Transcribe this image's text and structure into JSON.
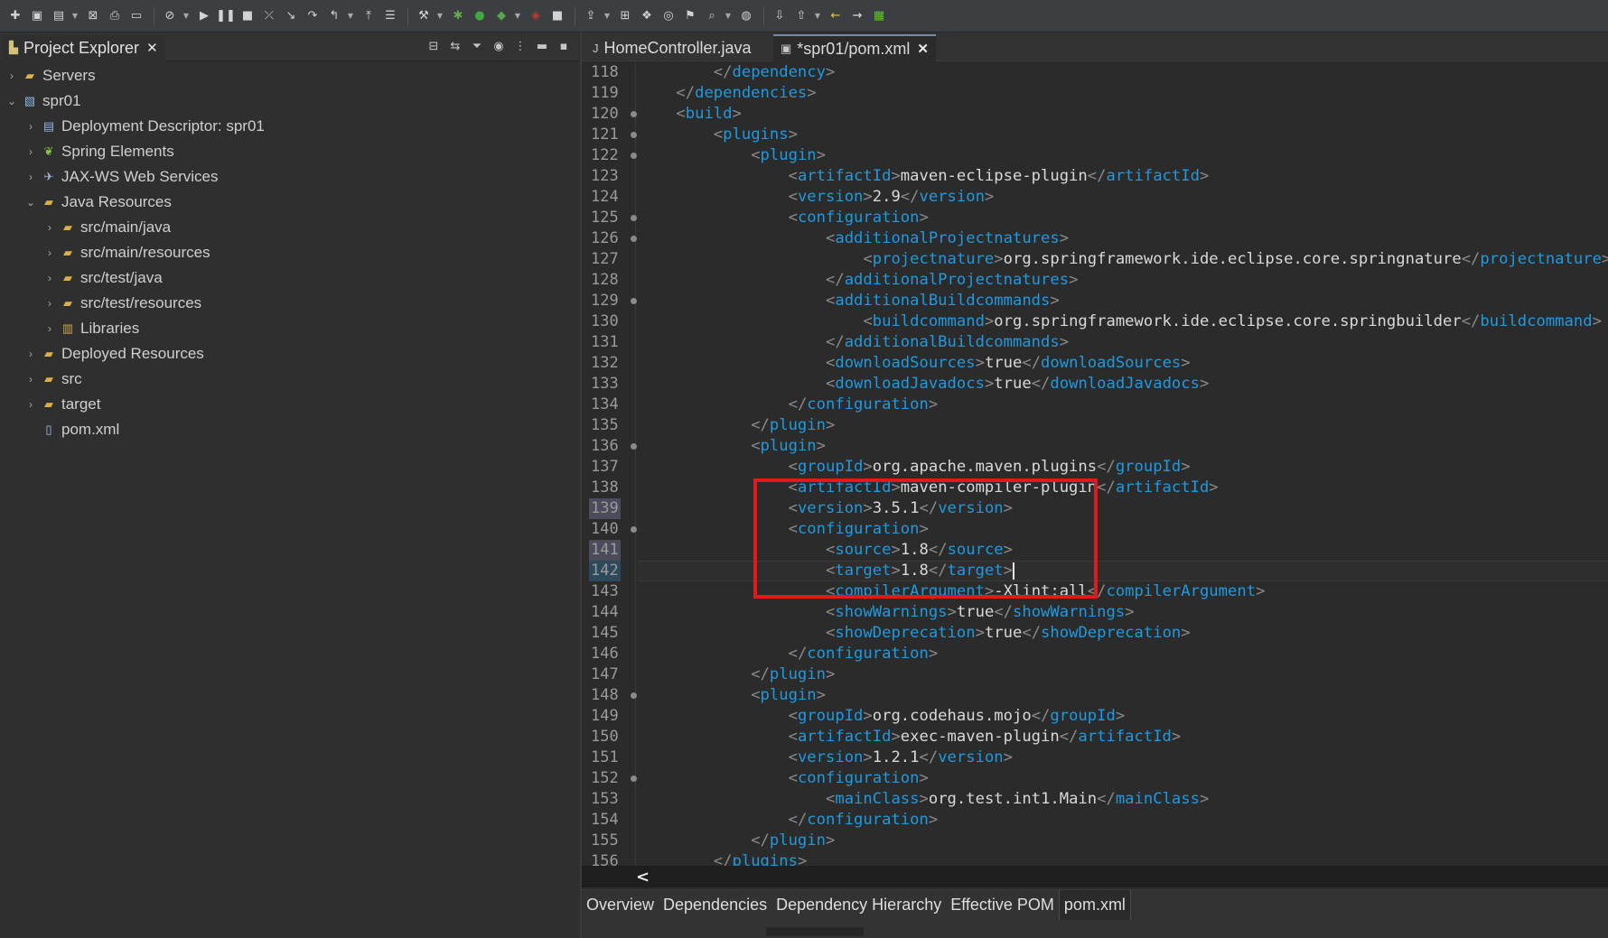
{
  "toolbar": {
    "icons": [
      "new-icon",
      "save-icon",
      "save-all-icon",
      "debug-skip-icon",
      "print-icon",
      "terminal-icon",
      "skip-breakpoints-icon",
      "resume-icon",
      "suspend-icon",
      "terminate-icon",
      "disconnect-icon",
      "step-into-icon",
      "step-over-icon",
      "step-return-icon",
      "drop-frame-icon",
      "use-step-filters-icon",
      "build-all-icon",
      "debug-icon",
      "run-icon",
      "run-server-icon",
      "external-tools-icon",
      "stop-icon",
      "deploy-icon",
      "new-server-icon",
      "new-java-project-icon",
      "open-type-icon",
      "open-task-icon",
      "search-icon",
      "open-perspective-icon",
      "next-annotation-icon",
      "prev-annotation-icon",
      "back-icon",
      "forward-icon",
      "outline-icon"
    ]
  },
  "project_explorer": {
    "title": "Project Explorer",
    "close_glyph": "✕",
    "tree": [
      {
        "label": "Servers",
        "level": 0,
        "twisty": "›",
        "icon": "folder-icon"
      },
      {
        "label": "spr01",
        "level": 0,
        "twisty": "⌄",
        "icon": "project-icon"
      },
      {
        "label": "Deployment Descriptor: spr01",
        "level": 1,
        "twisty": "›",
        "icon": "deployment-descriptor-icon"
      },
      {
        "label": "Spring Elements",
        "level": 1,
        "twisty": "›",
        "icon": "spring-icon"
      },
      {
        "label": "JAX-WS Web Services",
        "level": 1,
        "twisty": "›",
        "icon": "web-services-icon"
      },
      {
        "label": "Java Resources",
        "level": 1,
        "twisty": "⌄",
        "icon": "java-resources-icon"
      },
      {
        "label": "src/main/java",
        "level": 2,
        "twisty": "›",
        "icon": "package-folder-icon"
      },
      {
        "label": "src/main/resources",
        "level": 2,
        "twisty": "›",
        "icon": "package-folder-icon"
      },
      {
        "label": "src/test/java",
        "level": 2,
        "twisty": "›",
        "icon": "package-folder-icon"
      },
      {
        "label": "src/test/resources",
        "level": 2,
        "twisty": "›",
        "icon": "package-folder-icon"
      },
      {
        "label": "Libraries",
        "level": 2,
        "twisty": "›",
        "icon": "libraries-icon"
      },
      {
        "label": "Deployed Resources",
        "level": 1,
        "twisty": "›",
        "icon": "deployed-resources-icon"
      },
      {
        "label": "src",
        "level": 1,
        "twisty": "›",
        "icon": "folder-icon"
      },
      {
        "label": "target",
        "level": 1,
        "twisty": "›",
        "icon": "folder-icon"
      },
      {
        "label": "pom.xml",
        "level": 1,
        "twisty": "",
        "icon": "xml-file-icon"
      }
    ]
  },
  "editor": {
    "tabs": [
      {
        "label": "HomeController.java",
        "active": false
      },
      {
        "label": "*spr01/pom.xml",
        "active": true
      }
    ],
    "tab_close_glyph": "✕",
    "hscroll_arrow": "<",
    "bottom_tabs": [
      "Overview",
      "Dependencies",
      "Dependency Hierarchy",
      "Effective POM",
      "pom.xml"
    ],
    "active_bottom_tab": "pom.xml",
    "lines": [
      {
        "n": "118",
        "indent": 2,
        "tag": "dependency",
        "kind": "close"
      },
      {
        "n": "119",
        "indent": 1,
        "tag": "dependencies",
        "kind": "close"
      },
      {
        "n": "120",
        "indent": 1,
        "tag": "build",
        "kind": "open",
        "fold": true
      },
      {
        "n": "121",
        "indent": 2,
        "tag": "plugins",
        "kind": "open",
        "fold": true
      },
      {
        "n": "122",
        "indent": 3,
        "tag": "plugin",
        "kind": "open",
        "fold": true
      },
      {
        "n": "123",
        "indent": 4,
        "tag": "artifactId",
        "kind": "elem",
        "value": "maven-eclipse-plugin"
      },
      {
        "n": "124",
        "indent": 4,
        "tag": "version",
        "kind": "elem",
        "value": "2.9"
      },
      {
        "n": "125",
        "indent": 4,
        "tag": "configuration",
        "kind": "open",
        "fold": true
      },
      {
        "n": "126",
        "indent": 5,
        "tag": "additionalProjectnatures",
        "kind": "open",
        "fold": true
      },
      {
        "n": "127",
        "indent": 6,
        "tag": "projectnature",
        "kind": "elem",
        "value": "org.springframework.ide.eclipse.core.springnature"
      },
      {
        "n": "128",
        "indent": 5,
        "tag": "additionalProjectnatures",
        "kind": "close"
      },
      {
        "n": "129",
        "indent": 5,
        "tag": "additionalBuildcommands",
        "kind": "open",
        "fold": true
      },
      {
        "n": "130",
        "indent": 6,
        "tag": "buildcommand",
        "kind": "elem",
        "value": "org.springframework.ide.eclipse.core.springbuilder"
      },
      {
        "n": "131",
        "indent": 5,
        "tag": "additionalBuildcommands",
        "kind": "close"
      },
      {
        "n": "132",
        "indent": 5,
        "tag": "downloadSources",
        "kind": "elem",
        "value": "true"
      },
      {
        "n": "133",
        "indent": 5,
        "tag": "downloadJavadocs",
        "kind": "elem",
        "value": "true"
      },
      {
        "n": "134",
        "indent": 4,
        "tag": "configuration",
        "kind": "close"
      },
      {
        "n": "135",
        "indent": 3,
        "tag": "plugin",
        "kind": "close"
      },
      {
        "n": "136",
        "indent": 3,
        "tag": "plugin",
        "kind": "open",
        "fold": true
      },
      {
        "n": "137",
        "indent": 4,
        "tag": "groupId",
        "kind": "elem",
        "value": "org.apache.maven.plugins"
      },
      {
        "n": "138",
        "indent": 4,
        "tag": "artifactId",
        "kind": "elem",
        "value": "maven-compiler-plugin"
      },
      {
        "n": "139",
        "indent": 4,
        "tag": "version",
        "kind": "elem",
        "value": "3.5.1",
        "highlight": true
      },
      {
        "n": "140",
        "indent": 4,
        "tag": "configuration",
        "kind": "open",
        "fold": true
      },
      {
        "n": "141",
        "indent": 5,
        "tag": "source",
        "kind": "elem",
        "value": "1.8",
        "highlight": true
      },
      {
        "n": "142",
        "indent": 5,
        "tag": "target",
        "kind": "elem",
        "value": "1.8",
        "highlight": true,
        "current": true
      },
      {
        "n": "143",
        "indent": 5,
        "tag": "compilerArgument",
        "kind": "elem",
        "value": "-Xlint:all"
      },
      {
        "n": "144",
        "indent": 5,
        "tag": "showWarnings",
        "kind": "elem",
        "value": "true"
      },
      {
        "n": "145",
        "indent": 5,
        "tag": "showDeprecation",
        "kind": "elem",
        "value": "true"
      },
      {
        "n": "146",
        "indent": 4,
        "tag": "configuration",
        "kind": "close"
      },
      {
        "n": "147",
        "indent": 3,
        "tag": "plugin",
        "kind": "close"
      },
      {
        "n": "148",
        "indent": 3,
        "tag": "plugin",
        "kind": "open",
        "fold": true
      },
      {
        "n": "149",
        "indent": 4,
        "tag": "groupId",
        "kind": "elem",
        "value": "org.codehaus.mojo"
      },
      {
        "n": "150",
        "indent": 4,
        "tag": "artifactId",
        "kind": "elem",
        "value": "exec-maven-plugin"
      },
      {
        "n": "151",
        "indent": 4,
        "tag": "version",
        "kind": "elem",
        "value": "1.2.1"
      },
      {
        "n": "152",
        "indent": 4,
        "tag": "configuration",
        "kind": "open",
        "fold": true
      },
      {
        "n": "153",
        "indent": 5,
        "tag": "mainClass",
        "kind": "elem",
        "value": "org.test.int1.Main"
      },
      {
        "n": "154",
        "indent": 4,
        "tag": "configuration",
        "kind": "close"
      },
      {
        "n": "155",
        "indent": 3,
        "tag": "plugin",
        "kind": "close"
      },
      {
        "n": "156",
        "indent": 2,
        "tag": "plugins",
        "kind": "close"
      }
    ]
  },
  "colors": {
    "tag": "#1e9ae0",
    "bracket": "#8a8a8a",
    "text": "#d9d9d9",
    "annotation_box": "#e0191c"
  }
}
